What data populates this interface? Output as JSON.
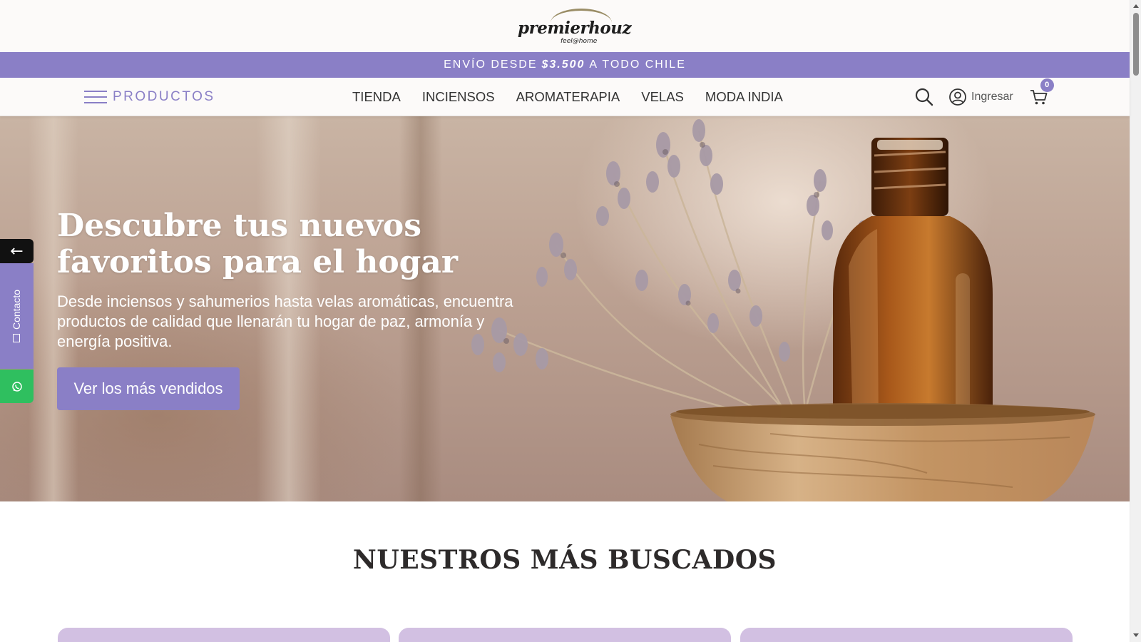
{
  "logo": {
    "main": "premierhouz",
    "tagline": "feel@home"
  },
  "promo": {
    "prefix": "ENVÍO DESDE",
    "amount": "$3.500",
    "suffix": "A TODO CHILE"
  },
  "nav": {
    "products_label": "PRODUCTOS",
    "items": [
      "TIENDA",
      "INCIENSOS",
      "AROMATERAPIA",
      "VELAS",
      "MODA INDIA"
    ],
    "login_label": "Ingresar",
    "cart_count": "0"
  },
  "hero": {
    "title": "Descubre tus nuevos favoritos para el hogar",
    "text": "Desde inciensos y sahumerios hasta velas aromáticas, encuentra productos de calidad que llenarán tu hogar de paz, armonía y energía positiva.",
    "cta_label": "Ver los más vendidos"
  },
  "side_widget": {
    "toggle_arrow": "←",
    "contact_label": "Contacto"
  },
  "section": {
    "title": "NUESTROS MÁS BUSCADOS"
  },
  "colors": {
    "accent": "#8a7fc6",
    "whatsapp": "#2fbf5f",
    "card": "#d2c0e2"
  }
}
